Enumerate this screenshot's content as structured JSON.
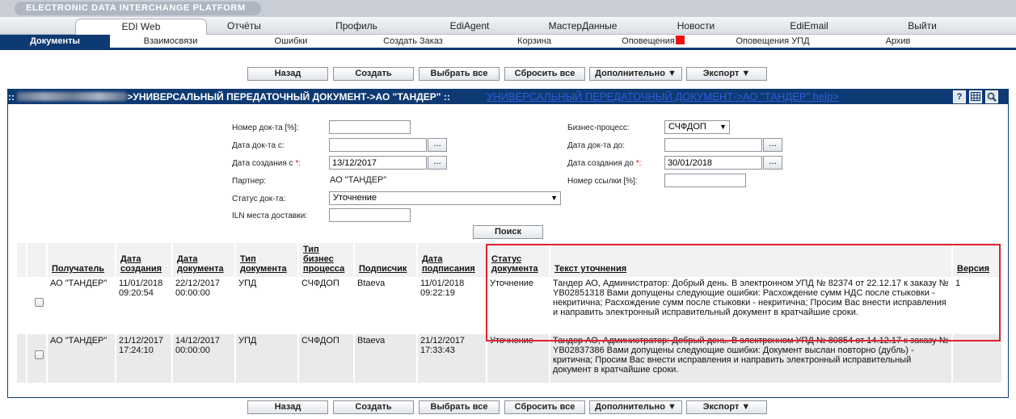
{
  "brand": {
    "title": "ELECTRONIC DATA INTERCHANGE PLATFORM"
  },
  "mainnav": [
    "EDI Web",
    "Отчёты",
    "Профиль",
    "EdiAgent",
    "МастерДанные",
    "Новости",
    "EdiEmail",
    "Выйти"
  ],
  "subnav": [
    "Документы",
    "Взаимосвязи",
    "Ошибки",
    "Создать Заказ",
    "Корзина",
    "Оповещения",
    "Оповещения УПД",
    "Архив"
  ],
  "buttons": {
    "back": "Назад",
    "create": "Создать",
    "select_all": "Выбрать все",
    "reset_all": "Сбросить все",
    "more": "Дополнительно ▼",
    "export": "Экспорт ▼"
  },
  "panel": {
    "title": ">УНИВЕРСАЛЬНЫЙ ПЕРЕДАТОЧНЫЙ ДОКУМЕНТ->АО \"ТАНДЕР\" ::",
    "title_prefix": "::",
    "help_link": "УНИВЕРСАЛЬНЫЙ ПЕРЕДАТОЧНЫЙ ДОКУМЕНТ->АО \"ТАНДЕР\" help>",
    "help_icon": "?",
    "table_icon": "grid-icon",
    "search_icon": "magnifier-icon"
  },
  "filters": {
    "doc_number_label": "Номер док-та [%]:",
    "doc_number_value": "",
    "doc_date_from_label": "Дата док-та с:",
    "doc_date_from_value": "",
    "created_from_label": "Дата создания с",
    "created_from_value": "13/12/2017",
    "partner_label": "Партнер:",
    "partner_value": "АО \"ТАНДЕР\"",
    "status_label": "Статус док-та:",
    "status_value": "Уточнение",
    "iln_label": "ILN места доставки:",
    "iln_value": "",
    "bp_label": "Бизнес-процесс:",
    "bp_value": "СЧФДОП",
    "doc_date_to_label": "Дата док-та до:",
    "doc_date_to_value": "",
    "created_to_label": "Дата создания до",
    "created_to_value": "30/01/2018",
    "ref_number_label": "Номер ссылки [%]:",
    "ref_number_value": "",
    "required_mark": "*:",
    "dots": "...",
    "search_button": "Поиск"
  },
  "table": {
    "headers": [
      "Получатель",
      "Дата создания",
      "Дата документа",
      "Тип документа",
      "Тип бизнес процесса",
      "Подписчик",
      "Дата подписания",
      "Статус документа",
      "Текст уточнения",
      "Версия"
    ],
    "rows": [
      {
        "recipient": "АО \"ТАНДЕР\"",
        "created": "11/01/2018 09:20:54",
        "doc_date": "22/12/2017 00:00:00",
        "doc_type": "УПД",
        "bp_type": "СЧФДОП",
        "signer": "Btaeva",
        "signed": "11/01/2018 09:22:19",
        "status": "Уточнение",
        "text": "Тандер АО, Администратор: Добрый день. В электронном УПД № 82374 от 22.12.17 к заказу № YB02851318 Вами допущены следующие ошибки: Расхождение сумм НДС после стыковки - некритична; Расхождение сумм после стыковки - некритична; Просим Вас внести исправления и направить электронный исправительный документ в кратчайшие сроки.",
        "version": "1"
      },
      {
        "recipient": "АО \"ТАНДЕР\"",
        "created": "21/12/2017 17:24:10",
        "doc_date": "14/12/2017 00:00:00",
        "doc_type": "УПД",
        "bp_type": "СЧФДОП",
        "signer": "Btaeva",
        "signed": "21/12/2017 17:33:43",
        "status": "Уточнение",
        "text": "Тандер АО, Администратор: Добрый день. В электронном УПД № 80854 от 14.12.17 к заказу № YB02837386 Вами допущены следующие ошибки: Документ выслан повторно (дубль) - критична; Просим Вас внести исправления и направить электронный исправительный документ в кратчайшие сроки.",
        "version": ""
      }
    ]
  },
  "colors": {
    "navy": "#0e3a73",
    "alert": "#ee1111",
    "highlight": "#e0242b"
  }
}
